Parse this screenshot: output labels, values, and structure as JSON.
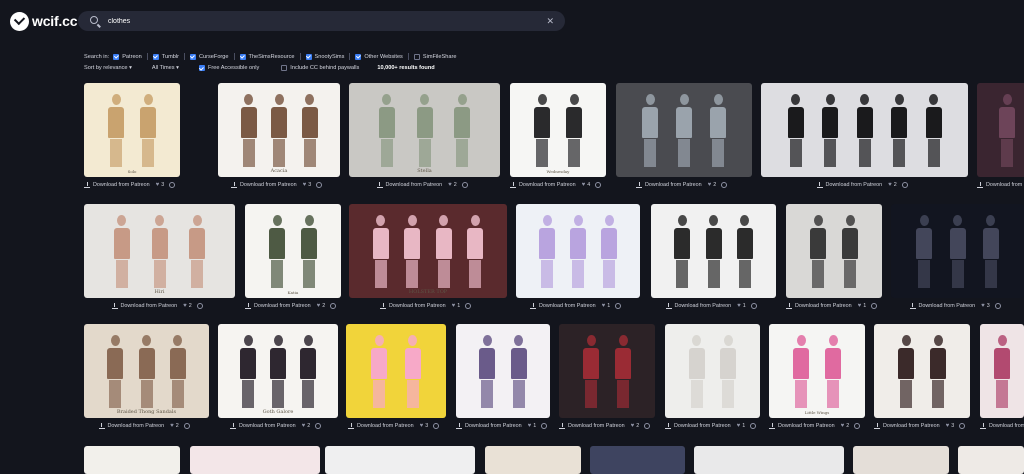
{
  "app": {
    "logo_text": "wcif.cc"
  },
  "search": {
    "value": "clothes",
    "placeholder": ""
  },
  "filters": {
    "search_in_label": "Search in:",
    "sources": [
      {
        "label": "Patreon",
        "checked": true
      },
      {
        "label": "Tumblr",
        "checked": true
      },
      {
        "label": "CurseForge",
        "checked": true
      },
      {
        "label": "TheSimsResource",
        "checked": true
      },
      {
        "label": "SnootySims",
        "checked": true
      },
      {
        "label": "Other Websites",
        "checked": true
      },
      {
        "label": "SimFileShare",
        "checked": false
      }
    ],
    "sort_label": "Sort by relevance",
    "time_label": "All Times",
    "free_accessible": {
      "label": "Free Accessible only",
      "checked": true
    },
    "include_paywall": {
      "label": "Include CC behind paywalls",
      "checked": false
    },
    "results_count": "10,000+ results found"
  },
  "download_label": "Download from Patreon",
  "cards": [
    {
      "likes": "3",
      "caption": "Solo"
    },
    {
      "likes": "3",
      "caption": "Acacia"
    },
    {
      "likes": "2",
      "caption": "Stella"
    },
    {
      "likes": "4",
      "caption": "Wednesday"
    },
    {
      "likes": "2",
      "caption": ""
    },
    {
      "likes": "2",
      "caption": ""
    },
    {
      "likes": "",
      "caption": ""
    },
    {
      "likes": "2",
      "caption": "Hiri"
    },
    {
      "likes": "2",
      "caption": "Katia"
    },
    {
      "likes": "1",
      "caption": "HOLSTER TOP"
    },
    {
      "likes": "1",
      "caption": ""
    },
    {
      "likes": "1",
      "caption": ""
    },
    {
      "likes": "1",
      "caption": ""
    },
    {
      "likes": "3",
      "caption": ""
    },
    {
      "likes": "2",
      "caption": "Braided Thong Sandals"
    },
    {
      "likes": "2",
      "caption": "Goth Galore"
    },
    {
      "likes": "3",
      "caption": ""
    },
    {
      "likes": "1",
      "caption": ""
    },
    {
      "likes": "2",
      "caption": ""
    },
    {
      "likes": "1",
      "caption": ""
    },
    {
      "likes": "2",
      "caption": "Little Wings"
    },
    {
      "likes": "3",
      "caption": ""
    },
    {
      "likes": "",
      "caption": ""
    }
  ],
  "colors": {
    "accent": "#3b7ef5",
    "background": "#13151d",
    "search_bg": "#262937"
  }
}
